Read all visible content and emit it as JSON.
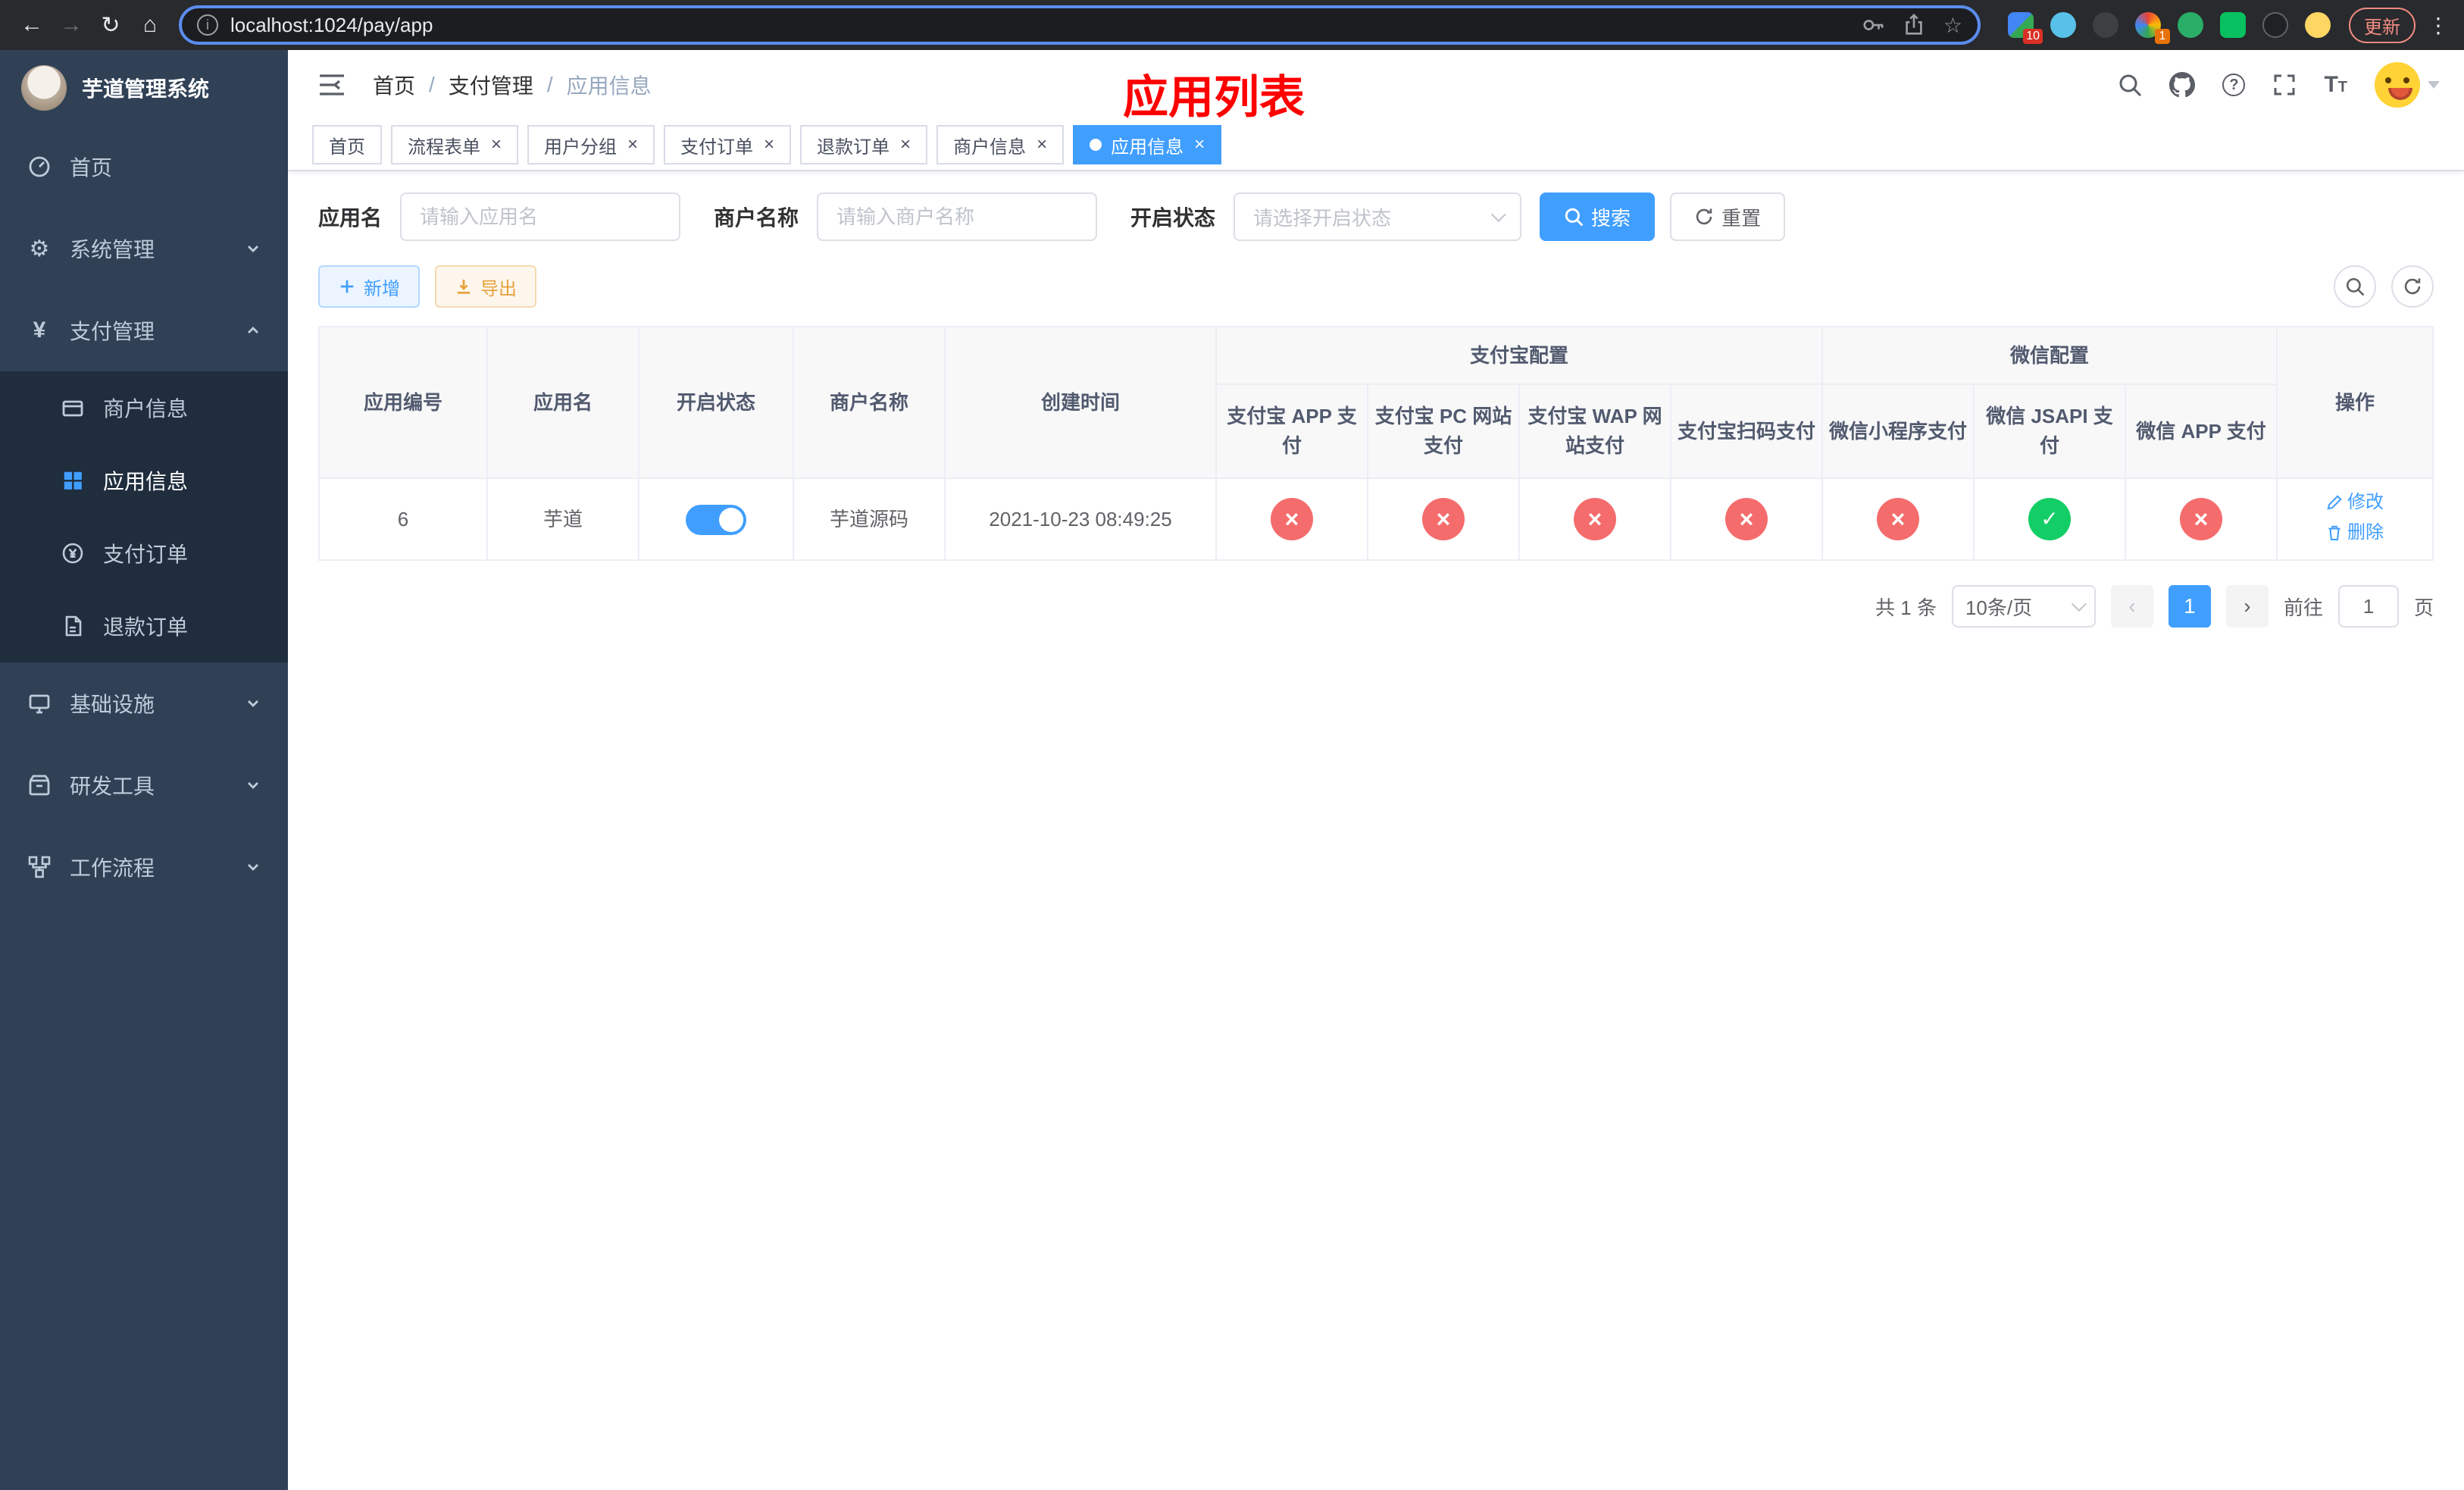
{
  "browser": {
    "url": "localhost:1024/pay/app",
    "update_label": "更新",
    "ext_badge_apps": "10",
    "ext_badge_color": "1"
  },
  "sidebar": {
    "title": "芋道管理系统",
    "items": [
      {
        "label": "首页"
      },
      {
        "label": "系统管理"
      },
      {
        "label": "支付管理"
      },
      {
        "label": "商户信息"
      },
      {
        "label": "应用信息"
      },
      {
        "label": "支付订单"
      },
      {
        "label": "退款订单"
      },
      {
        "label": "基础设施"
      },
      {
        "label": "研发工具"
      },
      {
        "label": "工作流程"
      }
    ]
  },
  "header": {
    "breadcrumb": {
      "home": "首页",
      "section": "支付管理",
      "current": "应用信息",
      "separator": "/"
    },
    "annotation": "应用列表"
  },
  "tabs": [
    {
      "label": "首页"
    },
    {
      "label": "流程表单"
    },
    {
      "label": "用户分组"
    },
    {
      "label": "支付订单"
    },
    {
      "label": "退款订单"
    },
    {
      "label": "商户信息"
    },
    {
      "label": "应用信息"
    }
  ],
  "filters": {
    "app_name_label": "应用名",
    "app_name_placeholder": "请输入应用名",
    "merchant_label": "商户名称",
    "merchant_placeholder": "请输入商户名称",
    "status_label": "开启状态",
    "status_placeholder": "请选择开启状态",
    "search_button": "搜索",
    "reset_button": "重置"
  },
  "toolbar": {
    "add_button": "新增",
    "export_button": "导出"
  },
  "table": {
    "headers": {
      "app_id": "应用编号",
      "app_name": "应用名",
      "status": "开启状态",
      "merchant": "商户名称",
      "create_time": "创建时间",
      "alipay_group": "支付宝配置",
      "wechat_group": "微信配置",
      "actions": "操作",
      "alipay_app": "支付宝 APP 支付",
      "alipay_pc": "支付宝 PC 网站支付",
      "alipay_wap": "支付宝 WAP 网站支付",
      "alipay_qr": "支付宝扫码支付",
      "wx_mini": "微信小程序支付",
      "wx_jsapi": "微信 JSAPI 支付",
      "wx_app": "微信 APP 支付"
    },
    "row": {
      "id": "6",
      "name": "芋道",
      "status_on": true,
      "merchant": "芋道源码",
      "create_time": "2021-10-23 08:49:25",
      "channels": [
        "no",
        "no",
        "no",
        "no",
        "no",
        "yes",
        "no"
      ],
      "edit": "修改",
      "delete": "删除"
    }
  },
  "pagination": {
    "total": "共 1 条",
    "page_size": "10条/页",
    "current_page": "1",
    "goto_label": "前往",
    "goto_value": "1",
    "page_unit": "页"
  },
  "colors": {
    "primary": "#409EFF",
    "success": "#13ce66",
    "danger": "#f56c6c",
    "warning": "#e6a23c",
    "annotation_red": "#ff0000",
    "sidebar_bg": "#304156",
    "submenu_bg": "#1f2d3d"
  }
}
